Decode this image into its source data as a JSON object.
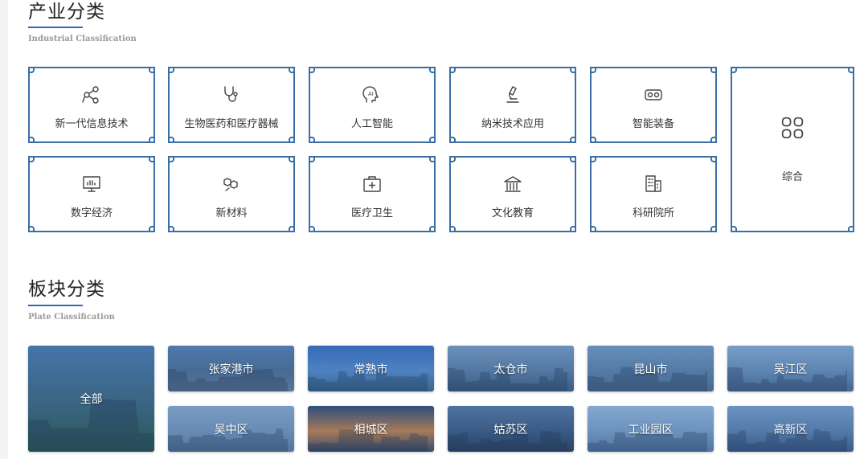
{
  "industrial": {
    "title": "产业分类",
    "subtitle": "Industrial Classification",
    "items": [
      {
        "label": "新一代信息技术",
        "icon": "network-nodes-icon"
      },
      {
        "label": "生物医药和医疗器械",
        "icon": "stethoscope-icon"
      },
      {
        "label": "人工智能",
        "icon": "ai-brain-icon"
      },
      {
        "label": "纳米技术应用",
        "icon": "microscope-icon"
      },
      {
        "label": "智能装备",
        "icon": "vr-headset-icon"
      },
      {
        "label": "综合",
        "icon": "grid-apps-icon"
      },
      {
        "label": "数字经济",
        "icon": "bar-chart-monitor-icon"
      },
      {
        "label": "新材料",
        "icon": "hexagon-molecule-icon"
      },
      {
        "label": "医疗卫生",
        "icon": "medical-kit-icon"
      },
      {
        "label": "文化教育",
        "icon": "museum-icon"
      },
      {
        "label": "科研院所",
        "icon": "office-building-icon"
      }
    ]
  },
  "plate": {
    "title": "板块分类",
    "subtitle": "Plate Classification",
    "items": [
      {
        "label": "全部"
      },
      {
        "label": "张家港市"
      },
      {
        "label": "常熟市"
      },
      {
        "label": "太仓市"
      },
      {
        "label": "昆山市"
      },
      {
        "label": "吴江区"
      },
      {
        "label": "吴中区"
      },
      {
        "label": "相城区"
      },
      {
        "label": "姑苏区"
      },
      {
        "label": "工业园区"
      },
      {
        "label": "高新区"
      }
    ]
  },
  "colors": {
    "accent": "#2b6cb8",
    "card_border": "#3b6fa3",
    "text": "#333333",
    "subtitle": "#9a9a9a"
  }
}
